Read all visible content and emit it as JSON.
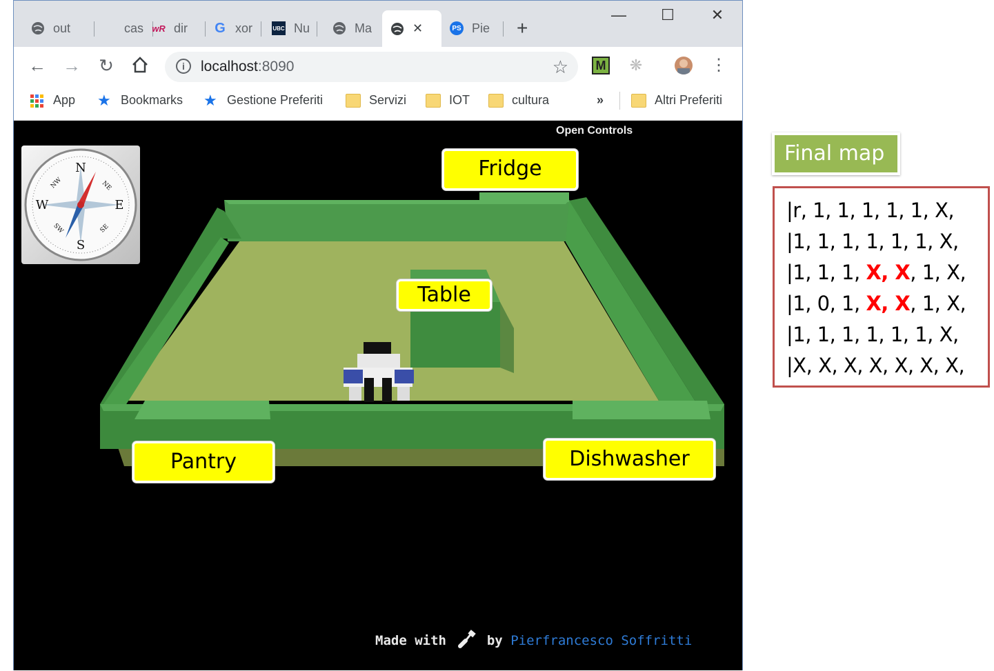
{
  "browser": {
    "tabs": [
      {
        "label": "out",
        "icon": "globe-icon"
      },
      {
        "label": "cas",
        "icon": "blank-icon"
      },
      {
        "label": "dir",
        "icon": "wr-icon"
      },
      {
        "label": "xor",
        "icon": "google-icon"
      },
      {
        "label": "Nu",
        "icon": "ubc-icon"
      },
      {
        "label": "Ma",
        "icon": "globe-icon"
      },
      {
        "label": "",
        "icon": "globe-icon",
        "active": true
      },
      {
        "label": "Pie",
        "icon": "ps-icon"
      }
    ],
    "new_tab": "+",
    "close_tab": "✕",
    "window": {
      "minimize": "—",
      "maximize": "☐",
      "close": "✕"
    },
    "address": {
      "host": "localhost",
      "port": ":8090"
    },
    "bookmarks": [
      {
        "label": "App",
        "icon": "apps-grid-icon"
      },
      {
        "label": "Bookmarks",
        "icon": "star-icon"
      },
      {
        "label": "Gestione Preferiti",
        "icon": "star-icon"
      },
      {
        "label": "Servizi",
        "icon": "folder-icon"
      },
      {
        "label": "IOT",
        "icon": "folder-icon"
      },
      {
        "label": "cultura",
        "icon": "folder-icon"
      }
    ],
    "more_bookmarks": "»",
    "other_bookmarks": "Altri Preferiti",
    "colors": {
      "tabstrip": "#dee1e6",
      "accent_blue": "#1a73e8"
    }
  },
  "scene": {
    "open_controls": "Open Controls",
    "compass": {
      "n": "N",
      "s": "S",
      "e": "E",
      "w": "W",
      "ne": "NE",
      "nw": "NW",
      "se": "SE",
      "sw": "SW"
    },
    "labels": {
      "fridge": "Fridge",
      "table": "Table",
      "pantry": "Pantry",
      "dishwasher": "Dishwasher"
    },
    "footer": {
      "made_with": "Made with",
      "by": "by",
      "author": "Pierfrancesco Soffritti"
    },
    "colors": {
      "wall": "#4c9a4c",
      "floor": "#9fb35e",
      "label_bg": "#ffff00"
    }
  },
  "side_panel": {
    "title": "Final map",
    "rows": [
      [
        {
          "t": "|r, 1, 1, 1, 1, 1, X,"
        }
      ],
      [
        {
          "t": "|1, 1, 1, 1, 1, 1, X,"
        }
      ],
      [
        {
          "t": "|1, 1, 1, "
        },
        {
          "t": "X, X",
          "hl": true
        },
        {
          "t": ", 1, X,"
        }
      ],
      [
        {
          "t": "|1, 0, 1, "
        },
        {
          "t": "X, X",
          "hl": true
        },
        {
          "t": ", 1, X,"
        }
      ],
      [
        {
          "t": "|1, 1, 1, 1, 1, 1, X,"
        }
      ],
      [
        {
          "t": "|X, X, X, X, X, X, X,"
        }
      ]
    ],
    "colors": {
      "title_bg": "#98b954",
      "border": "#c0504d",
      "highlight": "#ff0000"
    }
  }
}
